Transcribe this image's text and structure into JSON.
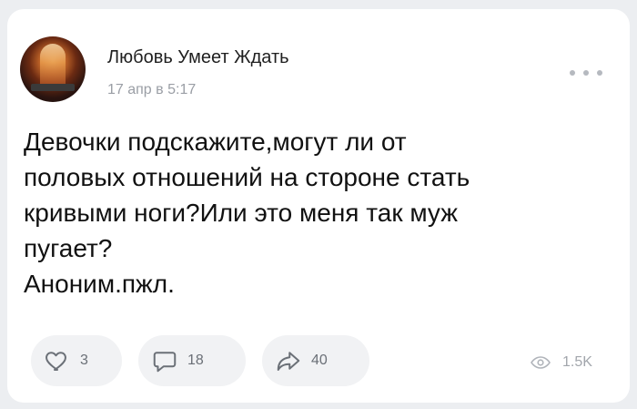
{
  "post": {
    "author": "Любовь Умеет Ждать",
    "time": "17 апр в 5:17",
    "lines": [
      "Девочки подскажите,могут ли от",
      "половых отношений на стороне стать",
      "кривыми ноги?Или это меня так муж",
      "пугает?",
      "Аноним.пжл."
    ]
  },
  "actions": {
    "likes": "3",
    "comments": "18",
    "shares": "40",
    "views": "1.5K"
  },
  "icons": {
    "like": "heart-icon",
    "comment": "comment-icon",
    "share": "share-icon",
    "views": "eye-icon",
    "more": "more-dots-icon"
  },
  "colors": {
    "background": "#eceef1",
    "card": "#ffffff",
    "text": "#111111",
    "muted": "#9a9ea5",
    "pill": "#f1f2f4",
    "icon": "#6b7077"
  }
}
